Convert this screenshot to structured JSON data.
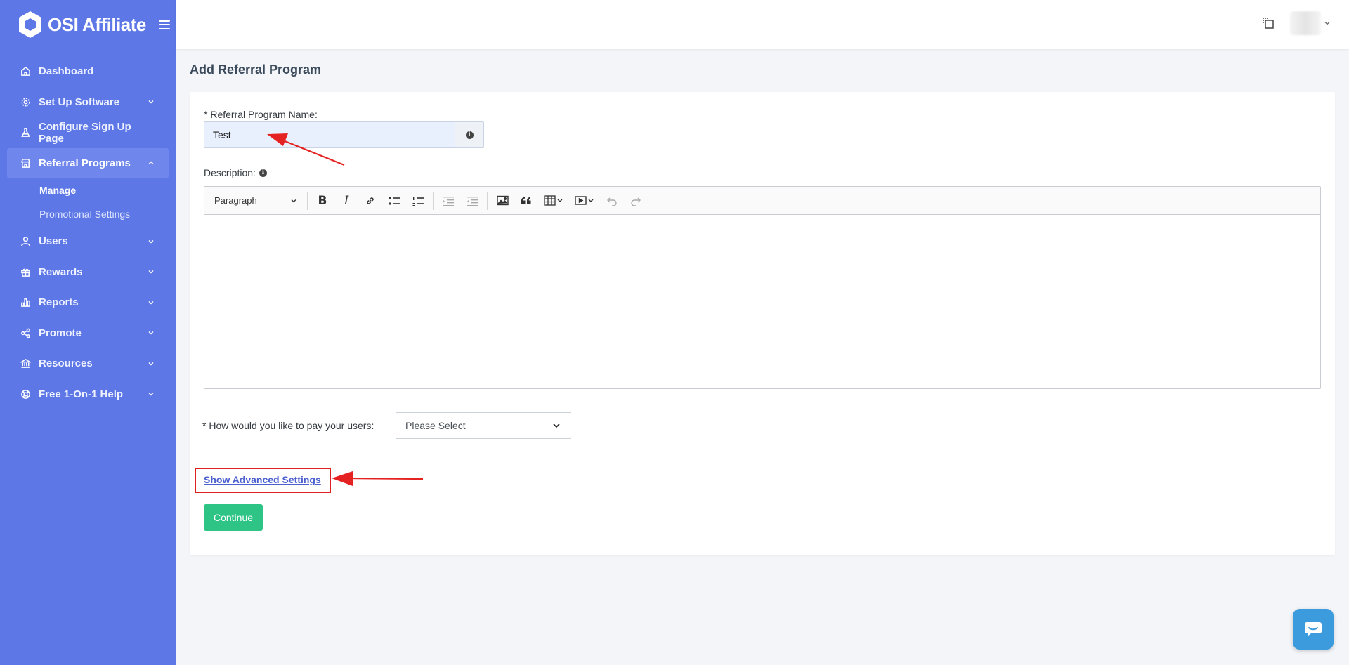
{
  "app": {
    "brand": "OSI Affiliate"
  },
  "sidebar": {
    "items": [
      {
        "label": "Dashboard",
        "icon": "home-icon"
      },
      {
        "label": "Set Up Software",
        "icon": "gear-icon"
      },
      {
        "label": "Configure Sign Up Page",
        "icon": "flask-icon"
      },
      {
        "label": "Referral Programs",
        "icon": "store-icon"
      },
      {
        "label": "Users",
        "icon": "user-icon"
      },
      {
        "label": "Rewards",
        "icon": "gift-icon"
      },
      {
        "label": "Reports",
        "icon": "bar-chart-icon"
      },
      {
        "label": "Promote",
        "icon": "share-icon"
      },
      {
        "label": "Resources",
        "icon": "bank-icon"
      },
      {
        "label": "Free 1-On-1 Help",
        "icon": "lifebuoy-icon"
      }
    ],
    "submenu": [
      {
        "label": "Manage"
      },
      {
        "label": "Promotional Settings"
      }
    ]
  },
  "page": {
    "title": "Add Referral Program"
  },
  "form": {
    "name_label": "* Referral Program Name:",
    "name_value": "Test",
    "description_label": "Description:",
    "editor": {
      "format": "Paragraph"
    },
    "pay_label": "* How would you like to pay your users:",
    "pay_value": "Please Select",
    "advanced_link": "Show Advanced Settings",
    "continue_label": "Continue"
  },
  "colors": {
    "sidebar": "#5d77e6",
    "primary_button": "#2ec486",
    "annotation": "#e02020",
    "chat": "#3c9bdc"
  }
}
